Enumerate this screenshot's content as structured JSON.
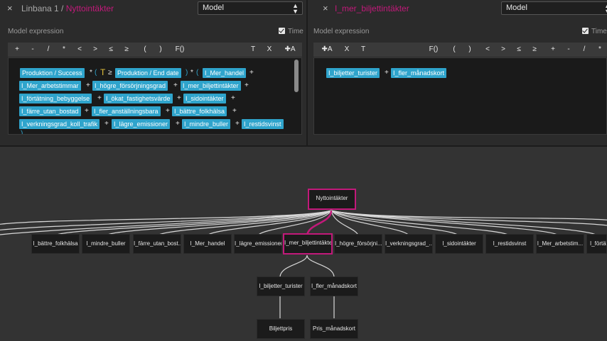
{
  "left_panel": {
    "close_icon": "×",
    "title_prefix": "Linbana 1 / ",
    "title_highlight": "Nyttointäkter",
    "view_select": "Model",
    "expression_label": "Model expression",
    "time_label": "Time",
    "toolbar": [
      "+",
      "-",
      "/",
      "*",
      "<",
      ">",
      "≤",
      "≥",
      "(",
      ")",
      "F()",
      "T",
      "X",
      "✚A"
    ],
    "expression": {
      "chips": [
        "Produktion / Success",
        "Produktion / End date",
        "I_Mer_handel",
        "I_Mer_arbetstimmar",
        "I_högre_försörjningsgrad",
        "I_mer_biljettintäkter",
        "I_förtätning_bebyggelse",
        "I_ökat_fastighetsvärde",
        "I_sidointäkter",
        "I_färre_utan_bostad",
        "I_fler_anställningsbara",
        "I_bättre_folkhälsa",
        "I_verkningsgrad_koll_trafik",
        "I_lägre_emissioner",
        "I_mindre_buller",
        "I_restidsvinst"
      ],
      "ops": [
        "*",
        "(",
        "T",
        "≥",
        ")",
        "*",
        "(",
        "+",
        "+",
        "+",
        "+",
        "+",
        "+",
        "+",
        "+",
        "+",
        "+",
        "+",
        "+",
        "+",
        ")"
      ]
    }
  },
  "right_panel": {
    "close_icon": "×",
    "title": "I_mer_biljettintäkter",
    "view_select": "Model",
    "expression_label": "Model expression",
    "time_label": "Time",
    "toolbar": [
      "✚A",
      "X",
      "T",
      "F()",
      "(",
      ")",
      "<",
      ">",
      "≤",
      "≥",
      "+",
      "-",
      "/",
      "*"
    ],
    "expression": {
      "chips": [
        "I_biljetter_turister",
        "I_fler_månadskort"
      ],
      "ops": [
        "+"
      ]
    }
  },
  "graph": {
    "root": "Nyttointäkter",
    "children": [
      "I_bättre_folkhälsa",
      "I_mindre_buller",
      "I_färre_utan_bost...",
      "I_Mer_handel",
      "I_lägre_emissioner",
      "I_mer_biljettintäkter",
      "I_högre_försörjni...",
      "I_verkningsgrad_...",
      "I_sidointäkter",
      "I_restidsvinst",
      "I_Mer_arbetstim...",
      "I_förtätni"
    ],
    "grandchildren": [
      "I_biljetter_turister",
      "I_fler_månadskort"
    ],
    "leaves": [
      "Biljettpris",
      "Pris_månadskort"
    ]
  },
  "colors": {
    "accent": "#c2197a",
    "chip": "#2fa4cc"
  }
}
